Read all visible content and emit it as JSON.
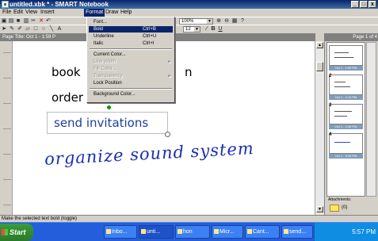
{
  "window": {
    "title": "untitled.xbk * - SMART Notebook",
    "controls": [
      "_",
      "□",
      "x"
    ]
  },
  "menubar": {
    "items": [
      "File",
      "Edit",
      "View",
      "Insert",
      "Format",
      "Draw",
      "Help"
    ]
  },
  "toolbar": {
    "zoom": "100%",
    "font_size": "12"
  },
  "page": {
    "title": "Page Title: Oct 1 - 1:59 P",
    "counter": "Page 1 of 4"
  },
  "format_menu": {
    "items": [
      {
        "label": "Font...",
        "shortcut": ""
      },
      {
        "label": "Bold",
        "shortcut": "Ctrl+B"
      },
      {
        "label": "Underline",
        "shortcut": "Ctrl+U"
      },
      {
        "label": "Italic",
        "shortcut": "Ctrl+I"
      },
      {
        "label": "Current Color...",
        "shortcut": ""
      },
      {
        "label": "Line Width",
        "shortcut": ""
      },
      {
        "label": "Fill Color...",
        "shortcut": ""
      },
      {
        "label": "Transparency",
        "shortcut": ""
      },
      {
        "label": "Lock Position",
        "shortcut": ""
      },
      {
        "label": "Background Color...",
        "shortcut": ""
      }
    ]
  },
  "canvas": {
    "line1_left": "book",
    "line1_right": "n",
    "line2": "order food",
    "line3": "send invitations",
    "line4": "organize sound system"
  },
  "thumbnails": [
    {
      "num": "",
      "caption": "Oct 1 - 1:59 PM"
    },
    {
      "num": "2",
      "caption": "Oct 1 - 2:11 PM"
    },
    {
      "num": "3",
      "caption": "Oct 1 - 2:40 PM"
    },
    {
      "num": "4",
      "caption": "Oct 1 - 5:06 PM"
    }
  ],
  "attachments": {
    "label": "Attachments:",
    "count": "(0)"
  },
  "status": "Make the selected text bold (toggle)",
  "taskbar": {
    "start": "Start",
    "buttons": [
      "Inbo...",
      "unti...",
      "hon",
      "Micr...",
      "Cant...",
      "send..."
    ],
    "clock": "5:57 PM"
  },
  "colors": {
    "titlebar": "#0a246a",
    "taskbar": "#245edb",
    "menu_highlight": "#0a246a",
    "ink_blue": "#1a2fb0"
  },
  "icons": [
    "app-icon",
    "new-icon",
    "open-icon",
    "save-icon",
    "print-icon",
    "delete-icon",
    "undo-icon",
    "select-icon",
    "pen-icon",
    "eraser-icon",
    "line-icon",
    "shape-icon",
    "text-icon",
    "bold-icon",
    "underline-icon",
    "start-flag-icon"
  ]
}
